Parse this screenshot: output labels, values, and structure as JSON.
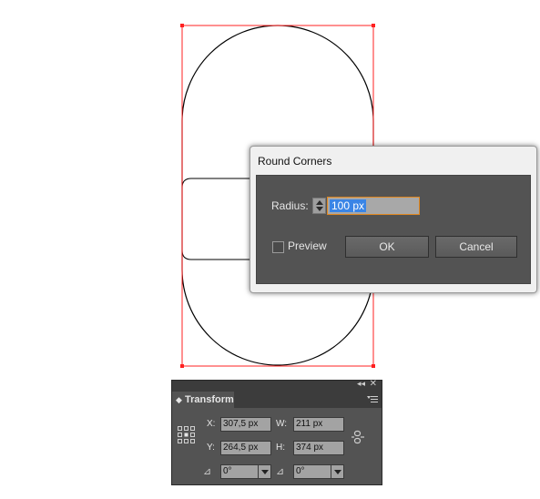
{
  "dialog": {
    "title": "Round Corners",
    "radius_label": "Radius:",
    "radius_value": "100 px",
    "preview_label": "Preview",
    "preview_checked": false,
    "ok_label": "OK",
    "cancel_label": "Cancel",
    "accent_color": "#3a85e6",
    "focus_color": "#e0871f"
  },
  "panel": {
    "title": "Transform",
    "x_label": "X:",
    "x_value": "307,5 px",
    "y_label": "Y:",
    "y_value": "264,5 px",
    "w_label": "W:",
    "w_value": "211 px",
    "h_label": "H:",
    "h_value": "374 px",
    "rotate_value": "0°",
    "shear_value": "0°",
    "icons": [
      "collapse-icon",
      "close-icon",
      "panel-menu-icon",
      "reference-point-icon",
      "constrain-proportions-icon",
      "rotate-icon",
      "shear-icon"
    ]
  },
  "canvas": {
    "selection_color": "#ff2020",
    "stroke_color": "#000000"
  }
}
